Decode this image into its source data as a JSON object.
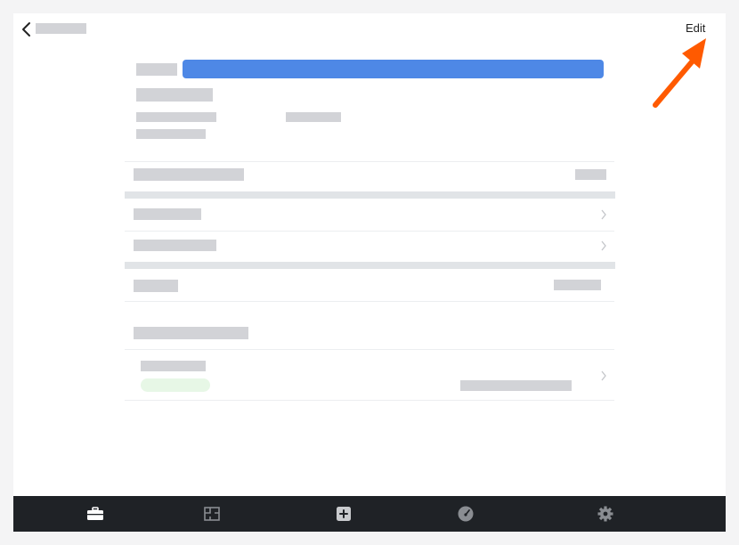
{
  "header": {
    "edit_label": "Edit"
  },
  "icons": {
    "back": "chevron-left-icon",
    "row_chevron": "chevron-right-icon",
    "annotation": "arrow-annotation"
  },
  "tabbar": {
    "items": [
      {
        "icon": "briefcase-icon",
        "active": true
      },
      {
        "icon": "floorplan-icon",
        "active": false
      },
      {
        "icon": "add-square-icon",
        "active": false
      },
      {
        "icon": "gauge-icon",
        "active": false
      },
      {
        "icon": "gear-icon",
        "active": false
      }
    ]
  },
  "colors": {
    "accent_blue": "#4e88e6",
    "status_green_bg": "#e7f7e6",
    "tabbar_bg": "#1f2226",
    "annotation_orange": "#ff5a00"
  }
}
